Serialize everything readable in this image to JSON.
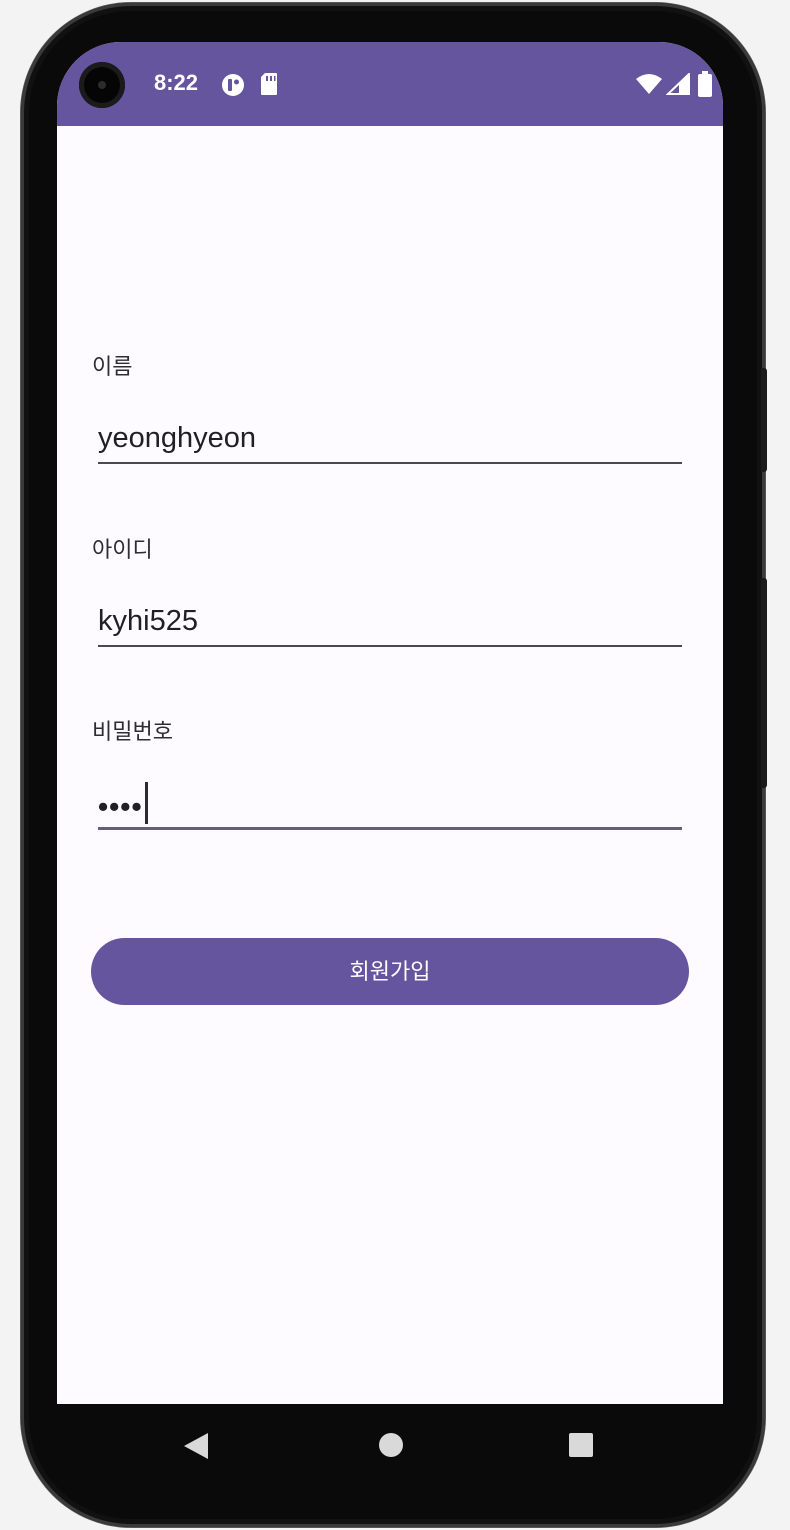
{
  "status_bar": {
    "time": "8:22",
    "icons": [
      "app-notification-icon",
      "sd-card-icon",
      "wifi-icon",
      "cellular-signal-icon",
      "battery-icon"
    ],
    "background_color": "#65559e"
  },
  "form": {
    "name": {
      "label": "이름",
      "value": "yeonghyeon"
    },
    "id": {
      "label": "아이디",
      "value": "kyhi525"
    },
    "password": {
      "label": "비밀번호",
      "masked_value": "••••"
    }
  },
  "signup_button": {
    "label": "회원가입",
    "color": "#65559e"
  },
  "navigation_bar": {
    "icons": [
      "back-icon",
      "home-icon",
      "recent-apps-icon"
    ]
  }
}
